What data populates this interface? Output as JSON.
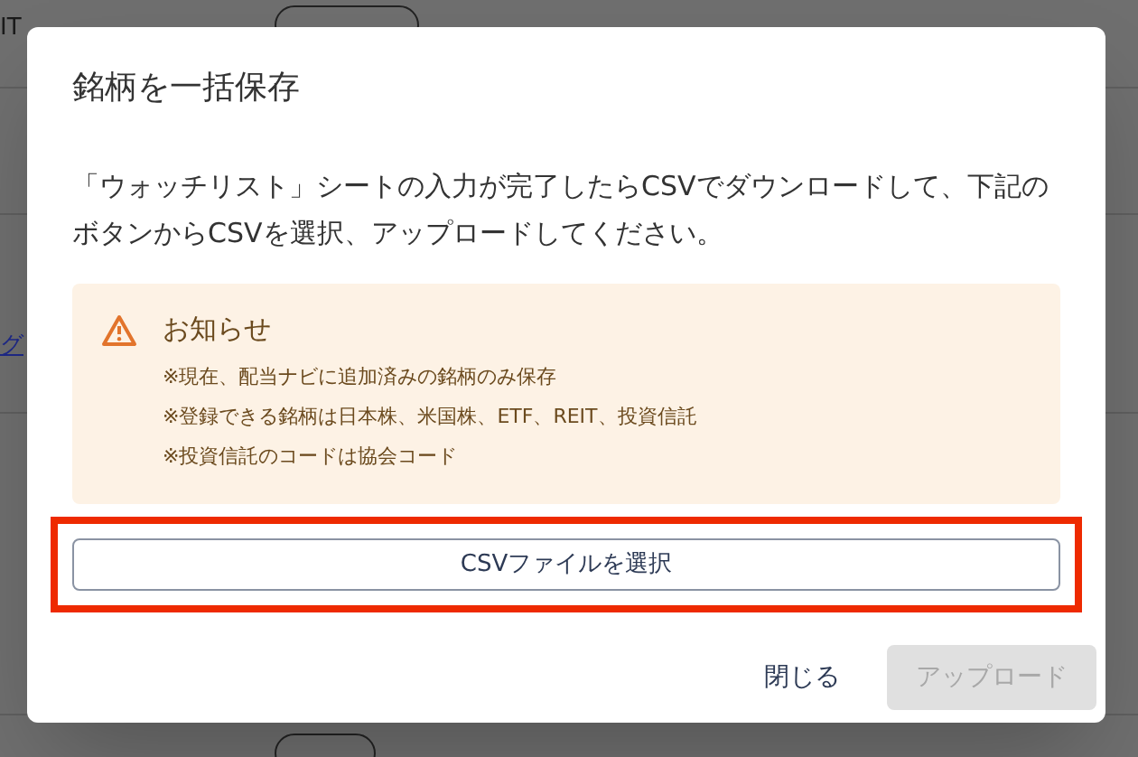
{
  "background": {
    "rows": [
      {
        "name": "IT"
      },
      {
        "link": "グ"
      }
    ]
  },
  "dialog": {
    "title": "銘柄を一括保存",
    "description": "「ウォッチリスト」シートの入力が完了したらCSVでダウンロードして、下記のボタンからCSVを選択、アップロードしてください。",
    "notice": {
      "title": "お知らせ",
      "items": [
        "※現在、配当ナビに追加済みの銘柄のみ保存",
        "※登録できる銘柄は日本株、米国株、ETF、REIT、投資信託",
        "※投資信託のコードは協会コード"
      ]
    },
    "file_button": {
      "label": "CSVファイルを選択",
      "highlighted": true
    },
    "buttons": [
      {
        "label": "閉じる",
        "disabled": false
      },
      {
        "label": "アップロード",
        "disabled": true
      }
    ]
  }
}
